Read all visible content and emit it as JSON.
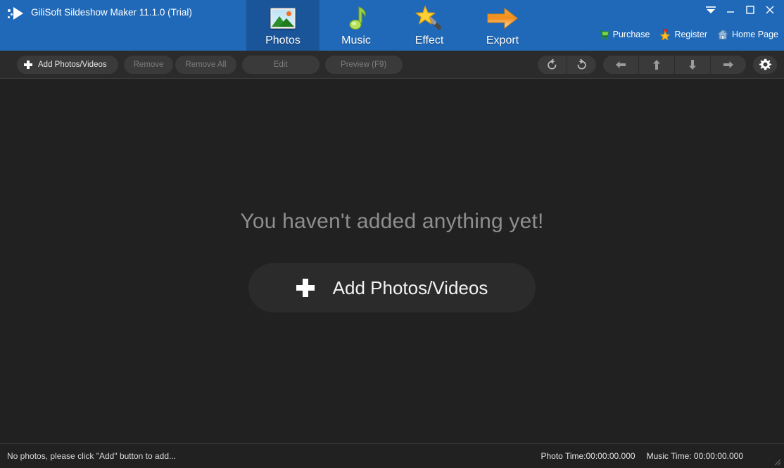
{
  "window": {
    "title": "GiliSoft Sildeshow Maker 11.1.0 (Trial)",
    "logo_icon": "play-logo-icon",
    "controls": [
      {
        "name": "collapse-button",
        "icon": "chevron-down-icon"
      },
      {
        "name": "minimize-button",
        "icon": "minimize-icon"
      },
      {
        "name": "maximize-button",
        "icon": "maximize-icon"
      },
      {
        "name": "close-button",
        "icon": "close-icon"
      }
    ]
  },
  "tabs": [
    {
      "label": "Photos",
      "icon": "picture-icon",
      "active": true
    },
    {
      "label": "Music",
      "icon": "music-note-icon",
      "active": false
    },
    {
      "label": "Effect",
      "icon": "magic-wand-icon",
      "active": false
    },
    {
      "label": "Export",
      "icon": "arrow-right-icon",
      "active": false
    }
  ],
  "header_links": [
    {
      "label": "Purchase",
      "icon": "shopping-cart-icon"
    },
    {
      "label": "Register",
      "icon": "star-icon"
    },
    {
      "label": "Home Page",
      "icon": "house-icon"
    }
  ],
  "toolbar": {
    "add_label": "Add Photos/Videos",
    "remove_label": "Remove",
    "remove_all_label": "Remove All",
    "edit_label": "Edit",
    "preview_label": "Preview (F9)",
    "rotate_left_icon": "rotate-left-icon",
    "rotate_right_icon": "rotate-right-icon",
    "move_left_icon": "arrow-left-icon",
    "move_up_icon": "arrow-up-icon",
    "move_down_icon": "arrow-down-icon",
    "move_right_icon": "arrow-right-icon",
    "settings_icon": "gear-icon"
  },
  "main": {
    "empty_message": "You haven't added anything yet!",
    "add_button_label": "Add Photos/Videos"
  },
  "statusbar": {
    "message": "No photos, please click \"Add\" button to add...",
    "photo_time": "Photo Time:00:00:00.000",
    "music_time": "Music Time:  00:00:00.000"
  },
  "colors": {
    "titlebar_blue": "#2069b8",
    "tab_active_blue": "#1a559a",
    "content_dark": "#212121",
    "toolbar_dark": "#2b2b2b",
    "pill_grey": "#3a3a3a",
    "accent_orange": "#f4701f",
    "music_green": "#8cc63f"
  }
}
